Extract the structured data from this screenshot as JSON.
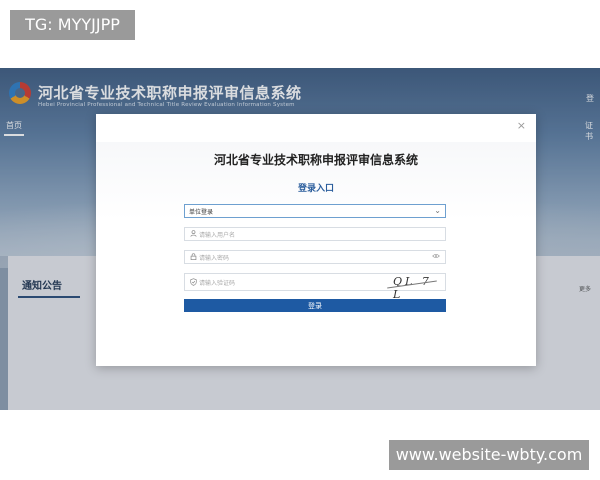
{
  "watermarks": {
    "top_left": "TG: MYYJJPP",
    "bottom_right": "www.website-wbty.com"
  },
  "site": {
    "title": "河北省专业技术职称申报评审信息系统",
    "subtitle": "Hebei Provincial Professional and Technical Title Review Evaluation Information System",
    "nav_home": "首页",
    "right_link_top": "登",
    "right_link_cert": "证书"
  },
  "notice": {
    "tab_label": "通知公告",
    "more": "更多"
  },
  "modal": {
    "close": "×",
    "title": "河北省专业技术职称申报评审信息系统",
    "login_heading": "登录入口",
    "select_value": "单位登录",
    "username_placeholder": "请输入用户名",
    "password_placeholder": "请输入密码",
    "captcha_placeholder": "请输入验证码",
    "captcha_text": "QL 7 L",
    "login_button": "登录"
  },
  "colors": {
    "accent": "#1e5aa3",
    "header": "#3f5d82"
  },
  "icons": {
    "user": "user-icon",
    "lock": "lock-icon",
    "shield": "shield-icon",
    "eye": "eye-icon",
    "chevron": "chevron-down-icon"
  }
}
